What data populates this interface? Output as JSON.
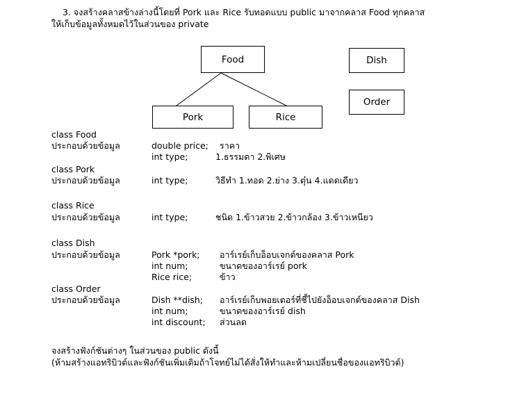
{
  "question": {
    "line1": "3. จงสร้างคลาสข้างล่างนี้โดยที่ Pork และ Rice รับทอดแบบ public มาจากคลาส Food ทุกคลาส",
    "line2": "ให้เก็บข้อมูลทั้งหมดไว้ในส่วนของ private"
  },
  "diagram": {
    "food": "Food",
    "pork": "Pork",
    "rice": "Rice",
    "dish": "Dish",
    "order": "Order"
  },
  "classes": {
    "food": {
      "header": "class Food",
      "label": "ประกอบด้วยข้อมูล",
      "rows": [
        {
          "decl": "double price;",
          "desc": "ราคา"
        },
        {
          "decl": "int type;",
          "desc": "1.ธรรมดา  2.พิเศษ"
        }
      ]
    },
    "pork": {
      "header": "class Pork",
      "label": "ประกอบด้วยข้อมูล",
      "rows": [
        {
          "decl": "int type;",
          "desc": "วิธีทำ 1.ทอด 2.ย่าง 3.ตุ๋น 4.แดดเดียว"
        }
      ]
    },
    "rice": {
      "header": "class Rice",
      "label": "ประกอบด้วยข้อมูล",
      "rows": [
        {
          "decl": "int type;",
          "desc": "ชนิด 1.ข้าวสวย  2.ข้าวกล้อง  3.ข้าวเหนียว"
        }
      ]
    },
    "dish": {
      "header": "class Dish",
      "label": "ประกอบด้วยข้อมูล",
      "rows": [
        {
          "decl": "Pork *pork;",
          "desc": "อาร์เรย์เก็บอ็อบเจกต์ของคลาส Pork"
        },
        {
          "decl": "int num;",
          "desc": "ขนาดของอาร์เรย์ pork"
        },
        {
          "decl": "Rice rice;",
          "desc": "ข้าว"
        }
      ]
    },
    "order": {
      "header": "class Order",
      "label": "ประกอบด้วยข้อมูล",
      "rows": [
        {
          "decl": "Dish **dish;",
          "desc": "อาร์เรย์เก็บพอยเตอร์ที่ชี้ไปยังอ็อบเจกต์ของคลาส Dish"
        },
        {
          "decl": "int num;",
          "desc": "ขนาดของอาร์เรย์ dish"
        },
        {
          "decl": "int discount;",
          "desc": "ส่วนลด"
        }
      ]
    }
  },
  "footer": {
    "line1": "จงสร้างฟังก์ชันต่างๆ ในส่วนของ public ดังนี้",
    "line2": "(ห้ามสร้างแอทริบิวต์และฟังก์ชันเพิ่มเติมถ้าโจทย์ไม่ได้สั่งให้ทำและห้ามเปลี่ยนชื่อของแอทริบิวต์)"
  }
}
